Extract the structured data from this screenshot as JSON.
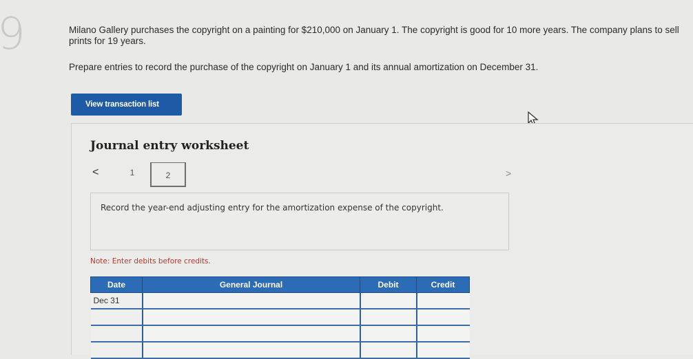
{
  "question": {
    "number": "9",
    "intro": "Milano Gallery purchases the copyright on a painting for $210,000 on January 1. The copyright is good for 10 more years. The company plans to sell prints for 19 years.",
    "prompt": "Prepare entries to record the purchase of the copyright on January 1 and its annual amortization on December 31."
  },
  "buttons": {
    "view_transactions": "View transaction list"
  },
  "worksheet": {
    "title": "Journal entry worksheet",
    "nav": {
      "prev": "<",
      "next": ">",
      "pages": [
        "1",
        "2"
      ],
      "current": "2"
    },
    "instruction": "Record the year-end adjusting entry for the amortization expense of the copyright.",
    "note": "Note: Enter debits before credits."
  },
  "journal": {
    "headers": {
      "date": "Date",
      "general_journal": "General Journal",
      "debit": "Debit",
      "credit": "Credit"
    },
    "rows": [
      {
        "date": "Dec 31",
        "account": "",
        "debit": "",
        "credit": ""
      },
      {
        "date": "",
        "account": "",
        "debit": "",
        "credit": ""
      },
      {
        "date": "",
        "account": "",
        "debit": "",
        "credit": ""
      },
      {
        "date": "",
        "account": "",
        "debit": "",
        "credit": ""
      }
    ]
  },
  "colors": {
    "button_blue": "#1f5aa6",
    "header_blue": "#2c6bb5",
    "note_red": "#b33b2e"
  }
}
